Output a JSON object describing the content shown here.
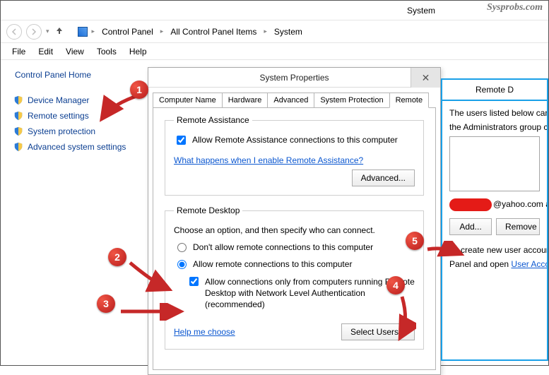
{
  "watermark": "Sysprobs.com",
  "window_title": "System",
  "breadcrumbs": [
    "Control Panel",
    "All Control Panel Items",
    "System"
  ],
  "menu": [
    "File",
    "Edit",
    "View",
    "Tools",
    "Help"
  ],
  "cphome": "Control Panel Home",
  "leftnav": [
    {
      "label": "Device Manager",
      "shield": true
    },
    {
      "label": "Remote settings",
      "shield": true
    },
    {
      "label": "System protection",
      "shield": true
    },
    {
      "label": "Advanced system settings",
      "shield": true
    }
  ],
  "dialog": {
    "title": "System Properties",
    "tabs": [
      "Computer Name",
      "Hardware",
      "Advanced",
      "System Protection",
      "Remote"
    ],
    "active_tab": 4,
    "ra_group": "Remote Assistance",
    "ra_allow": "Allow Remote Assistance connections to this computer",
    "ra_link": "What happens when I enable Remote Assistance?",
    "ra_advanced": "Advanced...",
    "rd_group": "Remote Desktop",
    "rd_intro": "Choose an option, and then specify who can connect.",
    "rd_opt1": "Don't allow remote connections to this computer",
    "rd_opt2": "Allow remote connections to this computer",
    "rd_nla": "Allow connections only from computers running Remote Desktop with Network Level Authentication (recommended)",
    "rd_help": "Help me choose",
    "rd_select": "Select Users..."
  },
  "users_dialog": {
    "title": "Remote D",
    "line1": "The users listed below can connect",
    "line2": "the Administrators group can conne",
    "already": "@yahoo.com already h",
    "add": "Add...",
    "remove": "Remove",
    "create1": "To create new user accounts or ad",
    "create2": "Panel and open ",
    "ua_link": "User Accounts"
  },
  "annotations": {
    "1": "1",
    "2": "2",
    "3": "3",
    "4": "4",
    "5": "5"
  }
}
